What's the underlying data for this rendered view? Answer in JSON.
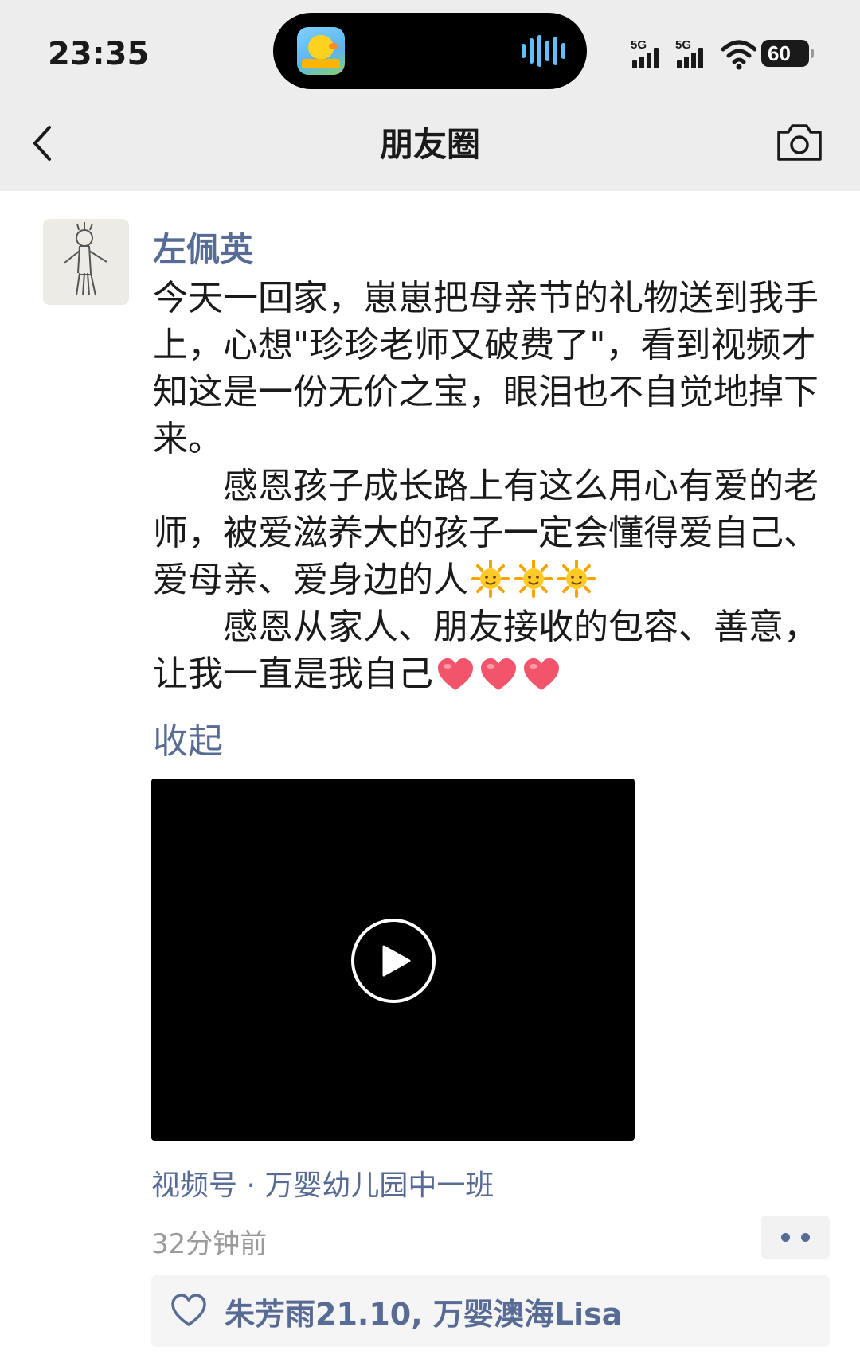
{
  "status_bar": {
    "time": "23:35",
    "signal_1_label": "5G",
    "signal_2_label": "5G",
    "battery": "60"
  },
  "header": {
    "title": "朋友圈",
    "back_icon": "chevron-left-icon",
    "camera_icon": "camera-icon"
  },
  "post": {
    "author": "左佩英",
    "paragraphs": [
      "今天一回家，崽崽把母亲节的礼物送到我手上，心想\"珍珍老师又破费了\"，看到视频才知这是一份无价之宝，眼泪也不自觉地掉下来。",
      "　　感恩孩子成长路上有这么用心有爱的老师，被爱滋养大的孩子一定会懂得爱自己、爱母亲、爱身边的人",
      "　　感恩从家人、朋友接收的包容、善意，让我一直是我自己"
    ],
    "collapse_label": "收起",
    "video_source": "视频号 · 万婴幼儿园中一班",
    "time_ago": "32分钟前",
    "likes": "朱芳雨21.10, 万婴澳海Lisa"
  },
  "colors": {
    "link_blue": "#576b95",
    "header_bg": "#ededed",
    "likes_bg": "#f5f5f5"
  }
}
